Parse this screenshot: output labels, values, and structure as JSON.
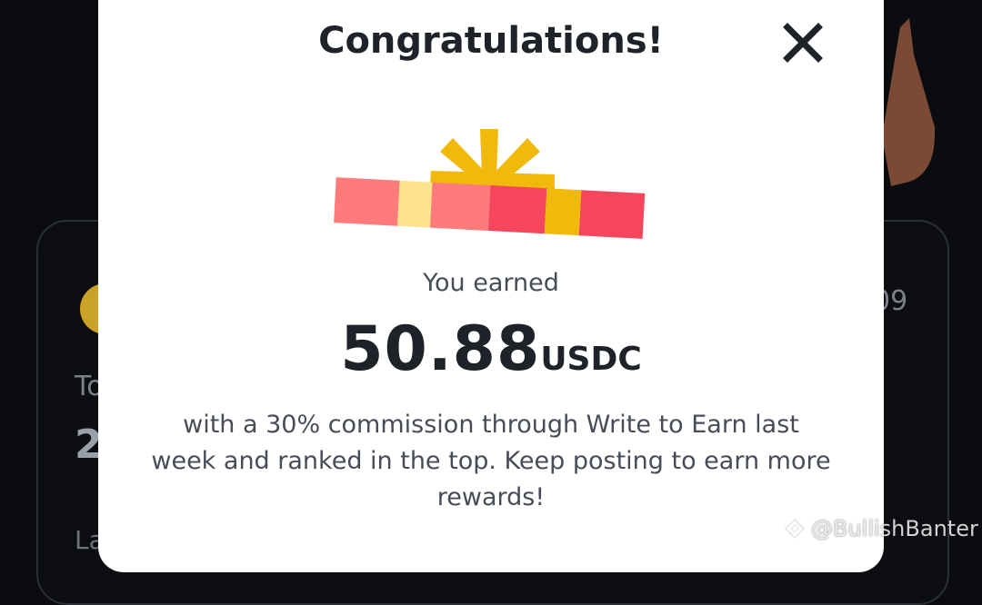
{
  "modal": {
    "title": "Congratulations!",
    "earned_label": "You earned",
    "amount": "50.88",
    "currency": "USDC",
    "description": "with a 30% commission through Write to Earn last week and ranked in the top. Keep posting to earn more rewards!"
  },
  "background": {
    "text_to": "To",
    "text_number": "2",
    "text_la": "La",
    "text_right": "09"
  },
  "watermark": {
    "handle": "@BullishBanter"
  },
  "colors": {
    "modal_bg": "#ffffff",
    "page_bg": "#0b0c0f",
    "text_primary": "#1e2329",
    "text_secondary": "#474d57",
    "gift_yellow": "#f0b90b",
    "gift_red": "#f6465d",
    "gift_pink": "#ff7a7a"
  },
  "icons": {
    "close": "close-icon",
    "gift": "gift-box-icon",
    "watermark_logo": "binance-square-logo-icon"
  }
}
